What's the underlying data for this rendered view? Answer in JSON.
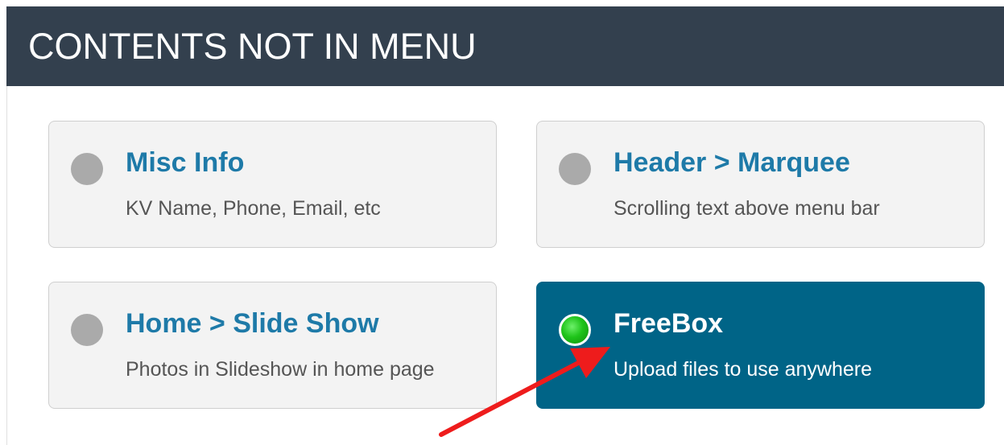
{
  "panel": {
    "title": "CONTENTS NOT IN MENU"
  },
  "cards": [
    {
      "title": "Misc Info",
      "description": "KV Name, Phone, Email, etc",
      "status": "inactive"
    },
    {
      "title": "Header > Marquee",
      "description": "Scrolling text above menu bar",
      "status": "inactive"
    },
    {
      "title": "Home > Slide Show",
      "description": "Photos in Slideshow in home page",
      "status": "inactive"
    },
    {
      "title": "FreeBox",
      "description": "Upload files to use anywhere",
      "status": "active"
    }
  ],
  "colors": {
    "header_bg": "#33404e",
    "card_bg": "#f3f3f3",
    "active_card_bg": "#006487",
    "title_link": "#1e7aa8",
    "inactive_dot": "#aaaaaa",
    "active_dot": "#1fc41a",
    "annotation_arrow": "#ee1c1c"
  }
}
